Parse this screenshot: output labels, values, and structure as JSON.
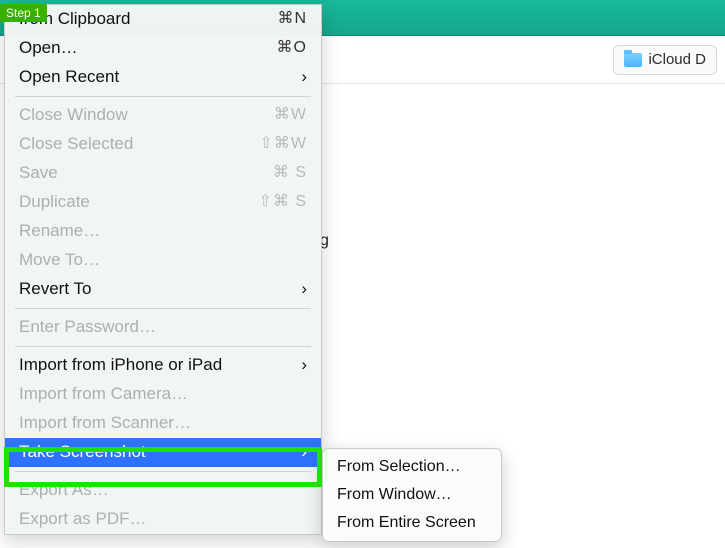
{
  "step_badge": "Step 1",
  "toolbar": {
    "icloud_label": "iCloud D"
  },
  "content_hint_tail": "g",
  "menu": {
    "items": [
      {
        "label": "from Clipboard",
        "shortcut": "⌘N",
        "enabled": true
      },
      {
        "label": "Open…",
        "shortcut": "⌘O",
        "enabled": true
      },
      {
        "label": "Open Recent",
        "chevron": true,
        "enabled": true
      },
      {
        "sep": true
      },
      {
        "label": "Close Window",
        "shortcut": "⌘W",
        "enabled": false
      },
      {
        "label": "Close Selected",
        "shortcut": "⇧⌘W",
        "enabled": false
      },
      {
        "label": "Save",
        "shortcut": "⌘ S",
        "enabled": false
      },
      {
        "label": "Duplicate",
        "shortcut": "⇧⌘ S",
        "enabled": false
      },
      {
        "label": "Rename…",
        "enabled": false
      },
      {
        "label": "Move To…",
        "enabled": false
      },
      {
        "label": "Revert To",
        "chevron": true,
        "enabled": true
      },
      {
        "sep": true
      },
      {
        "label": "Enter Password…",
        "enabled": false
      },
      {
        "sep": true
      },
      {
        "label": "Import from iPhone or iPad",
        "chevron": true,
        "enabled": true
      },
      {
        "label": "Import from Camera…",
        "enabled": false
      },
      {
        "label": "Import from Scanner…",
        "enabled": false
      },
      {
        "label": "Take Screenshot",
        "chevron": true,
        "enabled": true,
        "selected": true
      },
      {
        "sep": true
      },
      {
        "label": "Export As…",
        "enabled": false
      },
      {
        "label": "Export as PDF…",
        "enabled": false
      }
    ]
  },
  "submenu": {
    "items": [
      {
        "label": "From Selection…"
      },
      {
        "label": "From Window…"
      },
      {
        "label": "From Entire Screen"
      }
    ]
  }
}
